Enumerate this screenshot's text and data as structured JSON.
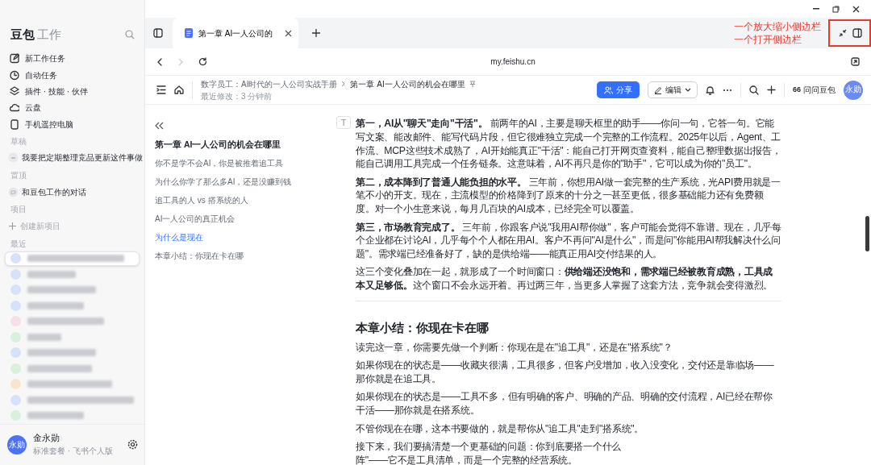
{
  "sidebar": {
    "brand": "豆包",
    "brand_sub": "工作",
    "menu": [
      {
        "kind": "edit",
        "label": "新工作任务"
      },
      {
        "kind": "clock",
        "label": "自动任务"
      },
      {
        "kind": "layers",
        "label": "插件 · 技能 · 伙伴"
      },
      {
        "kind": "cloud",
        "label": "云盘"
      },
      {
        "kind": "phone",
        "label": "手机遥控电脑"
      }
    ],
    "sections": [
      {
        "title": "草稿",
        "items": [
          {
            "kind": "draft",
            "label": "我要把定期整理竞品更新这件事做"
          }
        ]
      },
      {
        "title": "置顶",
        "items": [
          {
            "kind": "chat",
            "label": "和豆包工作的对话"
          }
        ]
      },
      {
        "title": "项目",
        "items": [
          {
            "kind": "add",
            "label": "创建新项目"
          }
        ]
      }
    ],
    "recent_title": "最近",
    "recent": [
      {
        "color": "#d6e2fb",
        "selected": true
      },
      {
        "color": "#d6e2fb",
        "selected": false
      },
      {
        "color": "#d6e2fb",
        "selected": false
      },
      {
        "color": "#d6e2fb",
        "selected": false
      },
      {
        "color": "#f6dfe6",
        "selected": false
      },
      {
        "color": "#d9f0dc",
        "selected": false
      },
      {
        "color": "#d6e2fb",
        "selected": false
      },
      {
        "color": "#d9f0dc",
        "selected": false
      },
      {
        "color": "#f9e4cf",
        "selected": false
      },
      {
        "color": "#d6e2fb",
        "selected": false
      },
      {
        "color": "#d9f0dc",
        "selected": false
      }
    ],
    "user": {
      "avatar": "永勋",
      "name": "金永勋",
      "chevron": "〉",
      "plan": "标准套餐 · 飞书个人版"
    }
  },
  "tabs": [
    {
      "title": "第一章 AI一人公司的",
      "selected": true
    }
  ],
  "annotation": {
    "lines": [
      "一个放大缩小侧边栏",
      "一个打开侧边栏"
    ]
  },
  "address": "my.feishu.cn",
  "doc_header": {
    "breadcrumb": [
      "数字员工：AI时代的一人公司实战手册",
      "第一章 AI一人公司的机会在哪里"
    ],
    "modified": "最近修改：3 分钟前",
    "share": "分享",
    "edit": "编辑",
    "ask_quote": "66",
    "ask": "问问豆包",
    "avatar": "永勋"
  },
  "outline": {
    "title": "第一章 AI一人公司的机会在哪里",
    "items": [
      {
        "label": "你不是学不会AI，你是被推着追工具",
        "selected": false
      },
      {
        "label": "为什么你学了那么多AI，还是没赚到钱",
        "selected": false
      },
      {
        "label": "追工具的人 vs 搭系统的人",
        "selected": false
      },
      {
        "label": "AI一人公司的真正机会",
        "selected": false
      },
      {
        "label": "为什么是现在",
        "selected": true
      },
      {
        "label": "本章小结：你现在卡在哪",
        "selected": false
      }
    ]
  },
  "block_handle": "T",
  "content": [
    {
      "kind": "paragraph",
      "text": "**第一，AI从\"聊天\"走向\"干活\"。** 前两年的AI，主要是聊天框里的助手——你问一句，它答一句。它能写文案、能改邮件、能写代码片段，但它很难独立完成一个完整的工作流程。2025年以后，Agent、工作流、MCP这些技术成熟了，AI开始能真正\"干活\"：能自己打开网页查资料，能自己整理数据出报告，能自己调用工具完成一个任务链条。这意味着，AI不再只是你的\"助手\"，它可以成为你的\"员工\"。"
    },
    {
      "kind": "paragraph",
      "text": "**第二，成本降到了普通人能负担的水平。** 三年前，你想用AI做一套完整的生产系统，光API费用就是一笔不小的开支。现在，主流模型的价格降到了原来的十分之一甚至更低，很多基础能力还有免费额度。对一个小生意来说，每月几百块的AI成本，已经完全可以覆盖。"
    },
    {
      "kind": "paragraph",
      "text": "**第三，市场教育完成了。** 三年前，你跟客户说\"我用AI帮你做\"，客户可能会觉得不靠谱。现在，几乎每个企业都在讨论AI，几乎每个个人都在用AI。客户不再问\"AI是什么\"，而是问\"你能用AI帮我解决什么问题\"。需求端已经准备好了，缺的是供给端——能真正用AI交付结果的人。"
    },
    {
      "kind": "paragraph",
      "text": "这三个变化叠加在一起，就形成了一个时间窗口：**供给端还没饱和，需求端已经被教育成熟，工具成本又足够低。**这个窗口不会永远开着。再过两三年，当更多人掌握了这套方法，竞争就会变得激烈。"
    },
    {
      "kind": "divider"
    },
    {
      "kind": "heading",
      "text": "本章小结：你现在卡在哪"
    },
    {
      "kind": "paragraph",
      "text": "读完这一章，你需要先做一个判断：你现在是在\"追工具\"，还是在\"搭系统\"？"
    },
    {
      "kind": "paragraph",
      "text": "如果你现在的状态是——收藏夹很满，工具很多，但客户没增加，收入没变化，交付还是靠临场——那你就是在追工具。"
    },
    {
      "kind": "paragraph",
      "text": "如果你现在的状态是——工具不多，但有明确的客户、明确的产品、明确的交付流程，AI已经在帮你干活——那你就是在搭系统。"
    },
    {
      "kind": "paragraph",
      "text": "不管你现在在哪，这本书要做的，就是帮你从\"追工具\"走到\"搭系统\"。"
    },
    {
      "kind": "paragraph",
      "text": "接下来，我们要搞清楚一个更基础的问题：你到底要搭一个什么"
    },
    {
      "kind": "paragraph",
      "text": "阵\"——它不是工具清单，而是一个完整的经营系统。"
    }
  ]
}
